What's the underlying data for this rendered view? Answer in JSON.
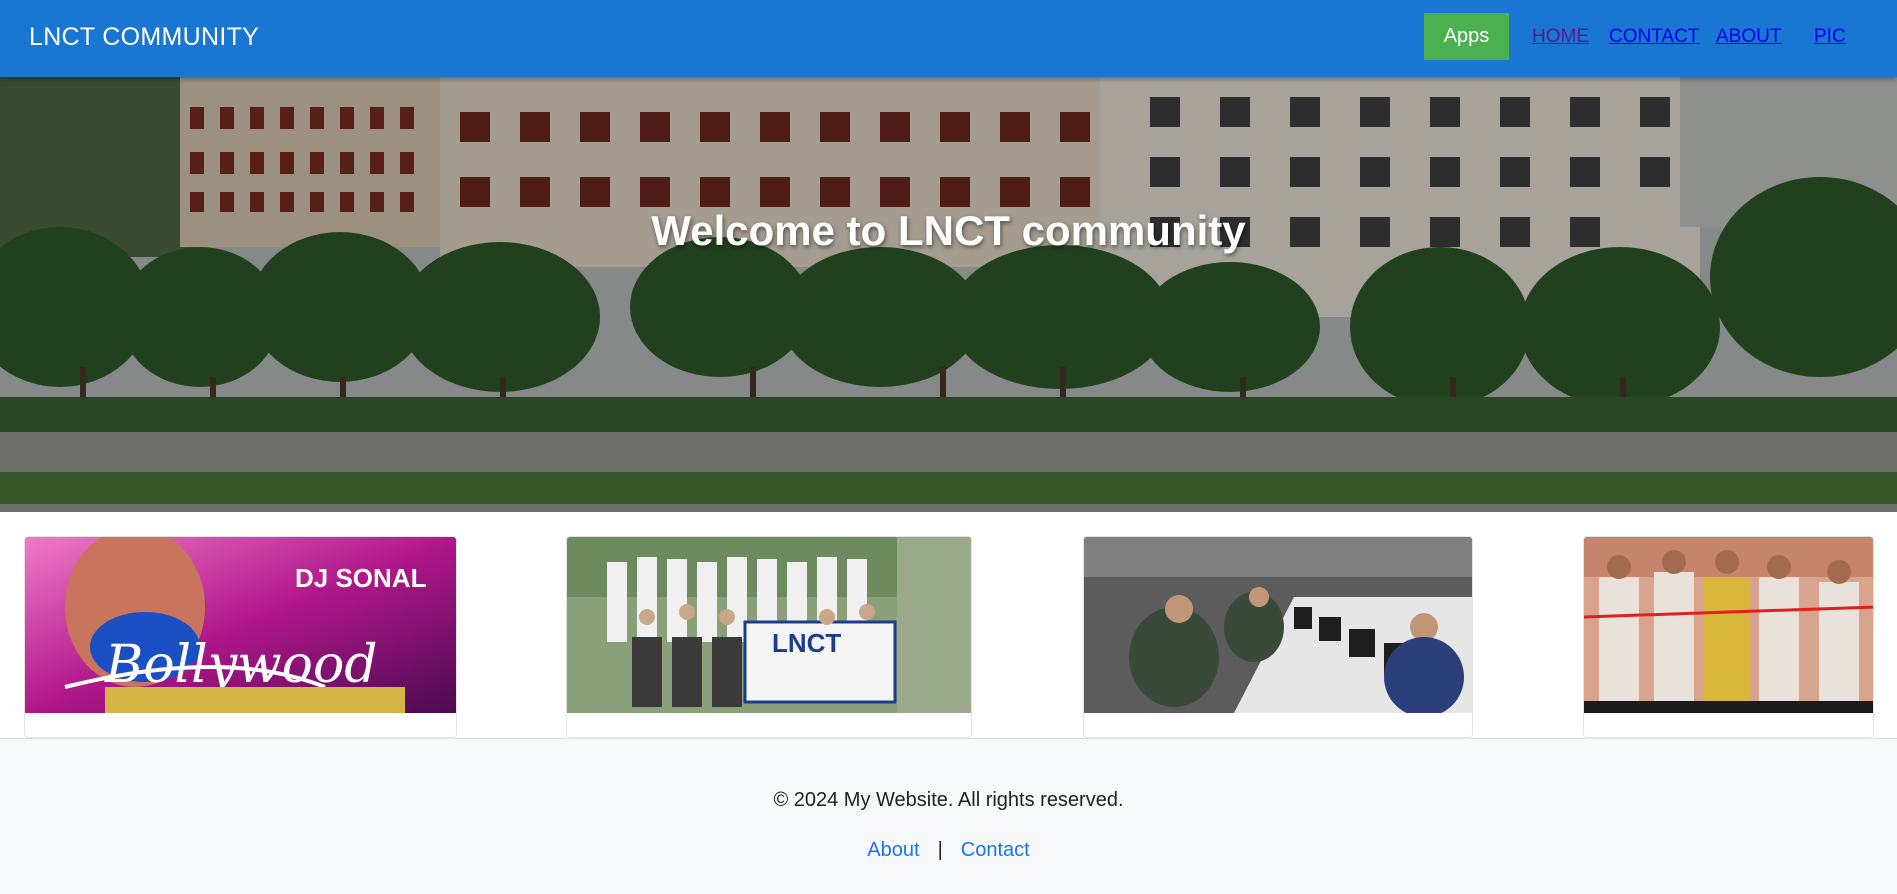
{
  "navbar": {
    "brand": "LNCT COMMUNITY",
    "apps_label": "Apps",
    "links": [
      {
        "label": "HOME"
      },
      {
        "label": "CONTACT"
      },
      {
        "label": "ABOUT"
      },
      {
        "label": "PIC"
      }
    ],
    "bg_color": "#1976d2",
    "apps_color": "#4caf50"
  },
  "hero": {
    "title": "Welcome to LNCT community"
  },
  "cards": [
    {
      "image": "bollywood-night-poster",
      "overlay_text": [
        "Bollywood",
        "DJ SONAL"
      ]
    },
    {
      "image": "ncc-naval-unit-group-photo",
      "overlay_text": [
        "LNCT"
      ]
    },
    {
      "image": "computer-lab-photo"
    },
    {
      "image": "drone-lab-inauguration-photo"
    }
  ],
  "footer": {
    "copyright": "© 2024 My Website. All rights reserved.",
    "about_label": "About",
    "separator": "|",
    "contact_label": "Contact"
  }
}
